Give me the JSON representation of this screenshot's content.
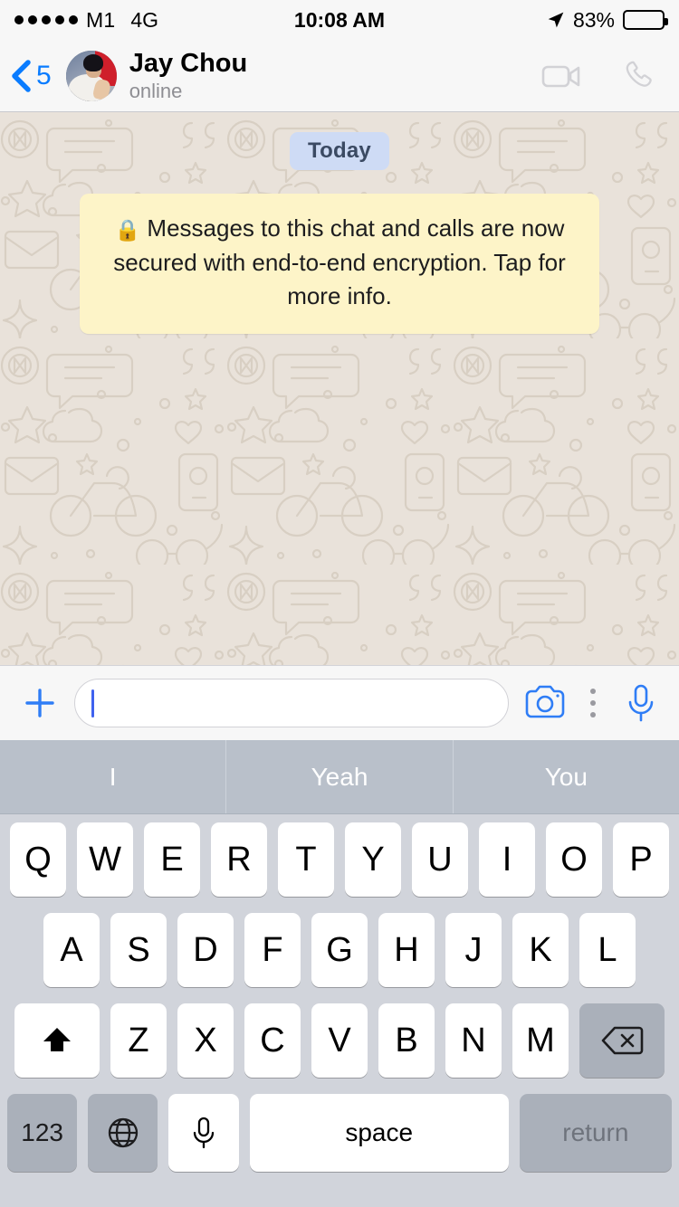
{
  "status_bar": {
    "signal_dots": 5,
    "carrier": "M1",
    "network": "4G",
    "time": "10:08 AM",
    "location_icon": "location-arrow-icon",
    "battery_percent": "83%",
    "battery_level": 83,
    "battery_color": "#ffcc00"
  },
  "header": {
    "back_label": "5",
    "back_icon": "chevron-left-icon",
    "contact_name": "Jay Chou",
    "contact_status": "online",
    "avatar_alt": "Jay Chou profile photo",
    "video_call_icon": "video-camera-icon",
    "voice_call_icon": "phone-icon",
    "accent_color": "#0a7cff"
  },
  "chat": {
    "day_divider": "Today",
    "day_divider_bg": "#cedbf5",
    "encryption_notice": "Messages to this chat and calls are now secured with end-to-end encryption. Tap for more info.",
    "encryption_lock_icon": "lock-icon",
    "encryption_bg": "#fdf4c8",
    "background_color": "#e9e2da"
  },
  "input_bar": {
    "attach_icon": "plus-icon",
    "message_value": "",
    "message_placeholder": "",
    "camera_icon": "camera-icon",
    "more_icon": "more-vertical-icon",
    "mic_icon": "microphone-icon"
  },
  "keyboard": {
    "suggestions": [
      "I",
      "Yeah",
      "You"
    ],
    "row1": [
      "Q",
      "W",
      "E",
      "R",
      "T",
      "Y",
      "U",
      "I",
      "O",
      "P"
    ],
    "row2": [
      "A",
      "S",
      "D",
      "F",
      "G",
      "H",
      "J",
      "K",
      "L"
    ],
    "row3": [
      "Z",
      "X",
      "C",
      "V",
      "B",
      "N",
      "M"
    ],
    "shift_icon": "shift-up-arrow-icon",
    "backspace_icon": "backspace-delete-icon",
    "numeric_label": "123",
    "globe_icon": "globe-language-icon",
    "dictation_icon": "microphone-icon",
    "space_label": "space",
    "return_label": "return",
    "background_color": "#d1d4db",
    "suggestion_bar_color": "#b9c0ca"
  }
}
